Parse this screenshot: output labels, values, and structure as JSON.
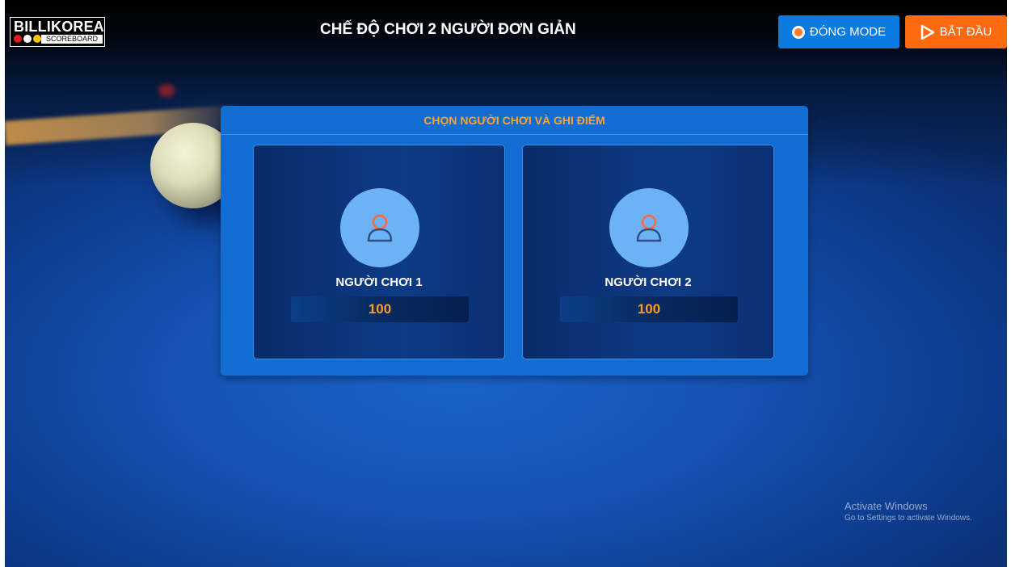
{
  "app": {
    "logo_name": "BILLIKOREA",
    "logo_sub": "SCOREBOARD",
    "title": "CHẾ ĐỘ CHƠI 2 NGƯỜI ĐƠN GIẢN"
  },
  "toolbar": {
    "close_mode_label": "ĐÓNG MODE",
    "start_label": "BẮT ĐẦU"
  },
  "panel": {
    "heading": "CHỌN NGƯỜI CHƠI VÀ GHI ĐIỂM",
    "players": [
      {
        "name": "NGƯỜI CHƠI 1",
        "score": "100"
      },
      {
        "name": "NGƯỜI CHƠI 2",
        "score": "100"
      }
    ]
  },
  "watermark": {
    "title": "Activate Windows",
    "subtitle": "Go to Settings to activate Windows."
  },
  "colors": {
    "accent_blue": "#0a7be0",
    "accent_orange": "#ff6a10",
    "score_orange": "#ff9e22",
    "panel_blue": "#126dd2"
  },
  "icons": {
    "close_mode": "back-arrow-icon",
    "start": "play-icon",
    "player_avatar": "user-icon"
  }
}
